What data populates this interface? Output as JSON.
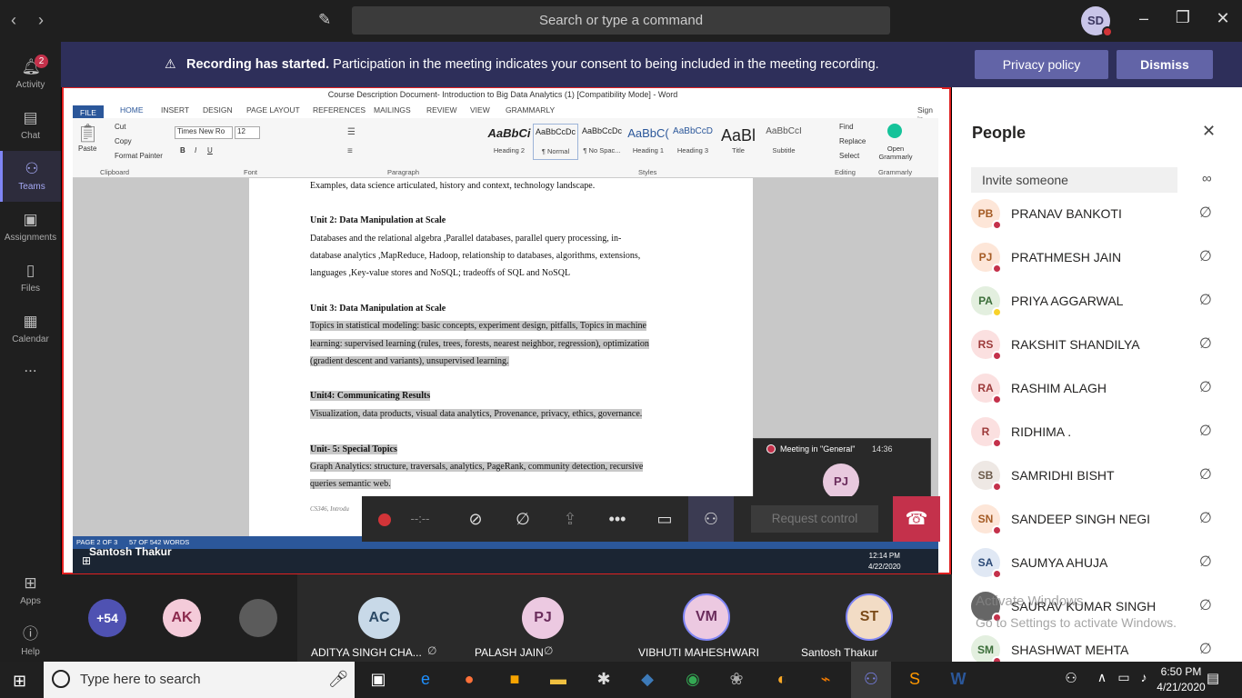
{
  "titlebar": {
    "search_placeholder": "Search or type a command",
    "avatar": "SD"
  },
  "rail": [
    {
      "label": "Activity",
      "icon": "bell-icon",
      "badge": "2"
    },
    {
      "label": "Chat",
      "icon": "chat-icon"
    },
    {
      "label": "Teams",
      "icon": "teams-icon",
      "active": true
    },
    {
      "label": "Assignments",
      "icon": "assignments-icon"
    },
    {
      "label": "Files",
      "icon": "files-icon"
    },
    {
      "label": "Calendar",
      "icon": "calendar-icon"
    },
    {
      "label": "...",
      "icon": "more-icon"
    },
    {
      "label": "Apps",
      "icon": "apps-icon"
    },
    {
      "label": "Help",
      "icon": "help-icon"
    }
  ],
  "banner": {
    "bold": "Recording has started.",
    "text": " Participation in the meeting indicates your consent to being included in the meeting recording.",
    "privacy": "Privacy policy",
    "dismiss": "Dismiss"
  },
  "word": {
    "title": "Course Description Document- Introduction to Big Data Analytics (1) [Compatibility Mode] - Word",
    "tabs": [
      "FILE",
      "HOME",
      "INSERT",
      "DESIGN",
      "PAGE LAYOUT",
      "REFERENCES",
      "MAILINGS",
      "REVIEW",
      "VIEW",
      "GRAMMARLY",
      "Sign in"
    ],
    "clipboard": {
      "paste": "Paste",
      "cut": "Cut",
      "copy": "Copy",
      "format_painter": "Format Painter",
      "label": "Clipboard"
    },
    "font": {
      "name": "Times New Ro",
      "size": "12",
      "label": "Font"
    },
    "paragraph_label": "Paragraph",
    "styles": [
      {
        "preview": "AaBbCi",
        "name": "Heading 2"
      },
      {
        "preview": "AaBbCcDc",
        "name": "¶ Normal"
      },
      {
        "preview": "AaBbCcDc",
        "name": "¶ No Spac..."
      },
      {
        "preview": "AaBbC(",
        "name": "Heading 1"
      },
      {
        "preview": "AaBbCcD",
        "name": "Heading 3"
      },
      {
        "preview": "AaBl",
        "name": "Title"
      },
      {
        "preview": "AaBbCcI",
        "name": "Subtitle"
      }
    ],
    "styles_label": "Styles",
    "editing": {
      "find": "Find",
      "replace": "Replace",
      "select": "Select",
      "label": "Editing"
    },
    "grammarly": {
      "open": "Open Grammarly",
      "label": "Grammarly"
    },
    "lines": [
      {
        "text": "Examples, data science articulated, history and context, technology landscape.",
        "head": false,
        "hl": false
      },
      {
        "text": "Unit 2: Data Manipulation at Scale",
        "head": true,
        "hl": false
      },
      {
        "text": "Databases and the relational algebra  ,Parallel databases, parallel query processing, in-",
        "head": false,
        "hl": false
      },
      {
        "text": "database analytics ,MapReduce, Hadoop, relationship to databases, algorithms, extensions,",
        "head": false,
        "hl": false
      },
      {
        "text": "languages  ,Key-value stores and NoSQL; tradeoffs of SQL and NoSQL",
        "head": false,
        "hl": false
      },
      {
        "text": "Unit 3: Data Manipulation at Scale",
        "head": true,
        "hl": false
      },
      {
        "text": "Topics in statistical modeling: basic concepts, experiment design, pitfalls, Topics in machine",
        "head": false,
        "hl": true
      },
      {
        "text": "learning: supervised learning (rules, trees, forests, nearest neighbor, regression), optimization",
        "head": false,
        "hl": true
      },
      {
        "text": "(gradient descent and variants), unsupervised learning.",
        "head": false,
        "hl": true
      },
      {
        "text": "Unit4: Communicating Results",
        "head": true,
        "hl": true
      },
      {
        "text": "Visualization, data products, visual data analytics, Provenance, privacy, ethics, governance.",
        "head": false,
        "hl": true
      },
      {
        "text": "Unit- 5: Special Topics",
        "head": true,
        "hl": true
      },
      {
        "text": "Graph Analytics: structure, traversals, analytics, PageRank, community detection, recursive",
        "head": false,
        "hl": true
      },
      {
        "text": "queries semantic web.",
        "head": false,
        "hl": true
      },
      {
        "text": "CS346, Introdu",
        "head": false,
        "hl": false
      }
    ],
    "status": {
      "page": "PAGE 2 OF 3",
      "words": "57 OF 542 WORDS"
    },
    "screen_user": "Santosh Thakur",
    "screen_clock": {
      "time": "12:14 PM",
      "date": "4/22/2020"
    }
  },
  "mini": {
    "title": "Meeting in \"General\"",
    "time": "14:36",
    "avatar": "PJ"
  },
  "controls": {
    "timer": "--:--",
    "request": "Request control"
  },
  "strip": [
    {
      "initials": "+54",
      "name": "",
      "bg": "#4f52b2",
      "fg": "#fff"
    },
    {
      "initials": "AK",
      "name": "",
      "bg": "#f4cbd9",
      "fg": "#8c2b4e"
    },
    {
      "initials": "",
      "name": "",
      "bg": "#5b5b5b",
      "fg": "#fff",
      "photo": true
    },
    {
      "initials": "AC",
      "name": "ADITYA SINGH CHA...",
      "bg": "#c8d9e8",
      "fg": "#2c4a66"
    },
    {
      "initials": "PJ",
      "name": "PALASH JAIN",
      "bg": "#ecc9e1",
      "fg": "#6a2c5c"
    },
    {
      "initials": "VM",
      "name": "VIBHUTI MAHESHWARI",
      "bg": "#ecc9e1",
      "fg": "#6a2c5c"
    },
    {
      "initials": "ST",
      "name": "Santosh Thakur",
      "bg": "#f2dcc5",
      "fg": "#7a4a18"
    }
  ],
  "people": {
    "title": "People",
    "invite": "Invite someone",
    "list": [
      {
        "initials": "PB",
        "name": "PRANAV BANKOTI",
        "bg": "#fde6d8",
        "fg": "#a55b24"
      },
      {
        "initials": "PJ",
        "name": "PRATHMESH JAIN",
        "bg": "#fde6d8",
        "fg": "#a55b24"
      },
      {
        "initials": "PA",
        "name": "PRIYA AGGARWAL",
        "bg": "#e3efdf",
        "fg": "#3c6e3a",
        "away": true
      },
      {
        "initials": "RS",
        "name": "RAKSHIT SHANDILYA",
        "bg": "#fbe0e0",
        "fg": "#9c3a3a"
      },
      {
        "initials": "RA",
        "name": "RASHIM ALAGH",
        "bg": "#fbe0e0",
        "fg": "#9c3a3a"
      },
      {
        "initials": "R",
        "name": "RIDHIMA .",
        "bg": "#fbe0e0",
        "fg": "#9c3a3a"
      },
      {
        "initials": "SB",
        "name": "SAMRIDHI BISHT",
        "bg": "#eee8e4",
        "fg": "#6b5a4a"
      },
      {
        "initials": "SN",
        "name": "SANDEEP SINGH NEGI",
        "bg": "#fde6d8",
        "fg": "#a55b24"
      },
      {
        "initials": "SA",
        "name": "SAUMYA AHUJA",
        "bg": "#e0e8f4",
        "fg": "#2c4a77"
      },
      {
        "initials": "",
        "name": "SAURAV KUMAR SINGH",
        "bg": "#666",
        "fg": "#fff",
        "photo": true
      },
      {
        "initials": "SM",
        "name": "SHASHWAT MEHTA",
        "bg": "#e3efdf",
        "fg": "#3c6e3a"
      }
    ],
    "watermark1": "Activate Windows",
    "watermark2": "Go to Settings to activate Windows."
  },
  "taskbar": {
    "search": "Type here to search",
    "time": "6:50 PM",
    "date": "4/21/2020"
  }
}
